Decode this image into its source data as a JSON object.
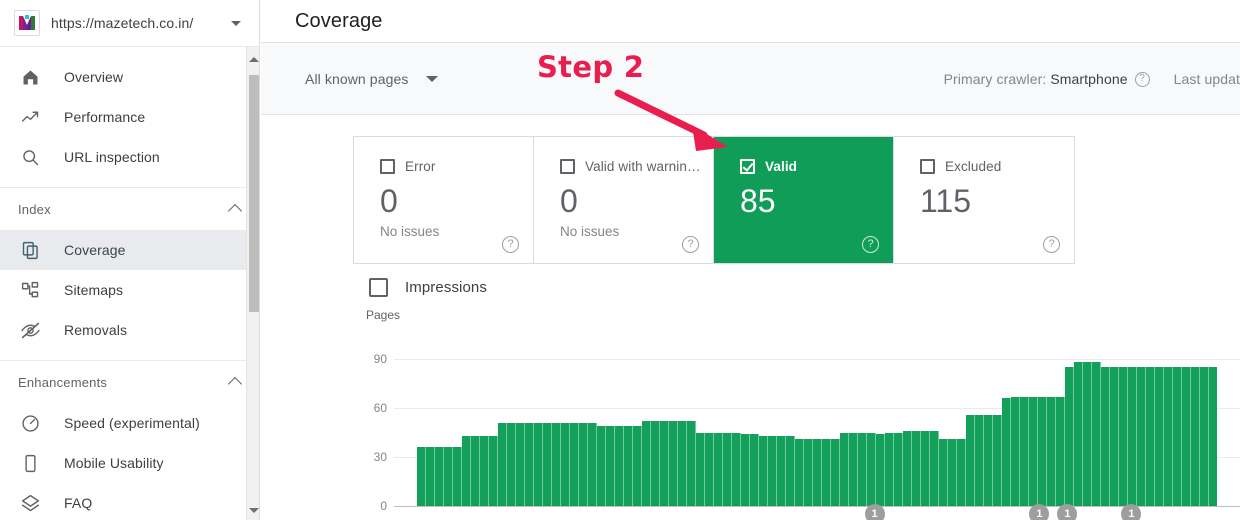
{
  "sidebar": {
    "property": {
      "url": "https://mazetech.co.in/",
      "favicon_icon": "mazetech-m-favicon",
      "dropdown_icon": "caret-down-icon"
    },
    "items": [
      {
        "label": "Overview",
        "icon": "home-icon",
        "active": false
      },
      {
        "label": "Performance",
        "icon": "trending-up-icon",
        "active": false
      },
      {
        "label": "URL inspection",
        "icon": "search-icon",
        "active": false
      }
    ],
    "sections": [
      {
        "label": "Index",
        "collapse_icon": "chevron-up-icon",
        "items": [
          {
            "label": "Coverage",
            "icon": "copy-pages-icon",
            "active": true
          },
          {
            "label": "Sitemaps",
            "icon": "sitemap-icon",
            "active": false
          },
          {
            "label": "Removals",
            "icon": "eye-off-icon",
            "active": false
          }
        ]
      },
      {
        "label": "Enhancements",
        "collapse_icon": "chevron-up-icon",
        "items": [
          {
            "label": "Speed (experimental)",
            "icon": "speedometer-icon",
            "active": false
          },
          {
            "label": "Mobile Usability",
            "icon": "mobile-icon",
            "active": false
          },
          {
            "label": "FAQ",
            "icon": "layers-icon",
            "active": false
          }
        ]
      }
    ],
    "scrollbar": {
      "up_icon": "scroll-up-arrow-icon",
      "down_icon": "scroll-down-arrow-icon"
    }
  },
  "header": {
    "title": "Coverage"
  },
  "toolbar": {
    "filter_label": "All known pages",
    "filter_icon": "caret-down-icon",
    "crawler_prefix": "Primary crawler:",
    "crawler_value": "Smartphone",
    "crawler_help_icon": "help-circle-icon",
    "last_updated": "Last updat"
  },
  "cards": [
    {
      "title": "Error",
      "value": "0",
      "subtitle": "No issues",
      "checked": false,
      "selected": false,
      "help_icon": "help-circle-icon"
    },
    {
      "title": "Valid with warnin…",
      "value": "0",
      "subtitle": "No issues",
      "checked": false,
      "selected": false,
      "help_icon": "help-circle-icon"
    },
    {
      "title": "Valid",
      "value": "85",
      "subtitle": "",
      "checked": true,
      "selected": true,
      "help_icon": "help-circle-icon"
    },
    {
      "title": "Excluded",
      "value": "115",
      "subtitle": "",
      "checked": false,
      "selected": false,
      "help_icon": "help-circle-icon"
    }
  ],
  "chart_panel": {
    "impressions_label": "Impressions",
    "impressions_checked": false
  },
  "annotation": {
    "step_label": "Step 2",
    "color": "#e91e4f",
    "arrow_icon": "arrow-down-right-icon"
  },
  "chart_data": {
    "type": "bar",
    "title": "",
    "xlabel": "",
    "ylabel": "Pages",
    "ylim": [
      0,
      90
    ],
    "yticks": [
      0,
      30,
      60,
      90
    ],
    "grid": true,
    "legend": "none",
    "series_color": "#13a05a",
    "series": [
      {
        "name": "Valid",
        "values": [
          36,
          36,
          36,
          36,
          36,
          43,
          43,
          43,
          43,
          51,
          51,
          51,
          51,
          51,
          51,
          51,
          51,
          51,
          51,
          51,
          49,
          49,
          49,
          49,
          49,
          52,
          52,
          52,
          52,
          52,
          52,
          45,
          45,
          45,
          45,
          45,
          44,
          44,
          43,
          43,
          43,
          43,
          41,
          41,
          41,
          41,
          41,
          45,
          45,
          45,
          45,
          44,
          45,
          45,
          46,
          46,
          46,
          46,
          41,
          41,
          41,
          56,
          56,
          56,
          56,
          66,
          67,
          67,
          67,
          67,
          67,
          67,
          85,
          88,
          88,
          88,
          85,
          85,
          85,
          85,
          85,
          85,
          85,
          85,
          85,
          85,
          85,
          85,
          85
        ]
      }
    ],
    "annotations": [
      {
        "label": "1",
        "x_fraction": 0.572
      },
      {
        "label": "1",
        "x_fraction": 0.778
      },
      {
        "label": "1",
        "x_fraction": 0.813
      },
      {
        "label": "1",
        "x_fraction": 0.893
      }
    ]
  }
}
